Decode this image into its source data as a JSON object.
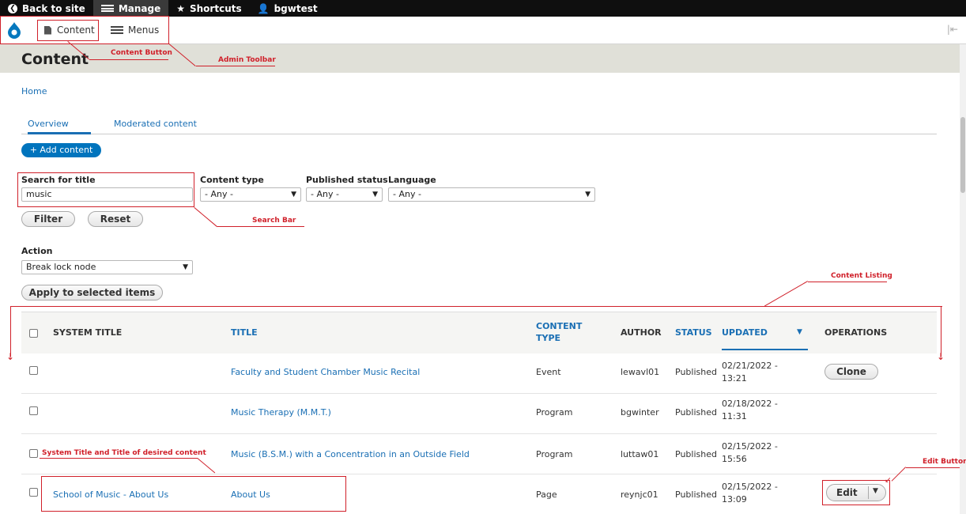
{
  "toolbar": {
    "back_to_site": "Back to site",
    "manage": "Manage",
    "shortcuts": "Shortcuts",
    "user": "bgwtest"
  },
  "tray": {
    "content": "Content",
    "menus": "Menus"
  },
  "page": {
    "title": "Content",
    "breadcrumb": "Home"
  },
  "tabs": [
    "Overview",
    "Moderated content"
  ],
  "add_content": "+ Add content",
  "filters": {
    "search_label": "Search for title",
    "search_value": "music",
    "content_type_label": "Content type",
    "content_type_value": "- Any -",
    "published_label": "Published status",
    "published_value": "- Any -",
    "language_label": "Language",
    "language_value": "- Any -",
    "filter_button": "Filter",
    "reset_button": "Reset"
  },
  "action": {
    "label": "Action",
    "value": "Break lock node",
    "apply_button": "Apply to selected items"
  },
  "table": {
    "headers": {
      "system_title": "SYSTEM TITLE",
      "title": "TITLE",
      "content_type_1": "CONTENT",
      "content_type_2": "TYPE",
      "author": "AUTHOR",
      "status": "STATUS",
      "updated": "UPDATED",
      "operations": "OPERATIONS"
    },
    "rows": [
      {
        "system_title": "",
        "title": "Faculty and Student Chamber Music Recital",
        "type": "Event",
        "author": "lewavl01",
        "status": "Published",
        "date": "02/21/2022 -",
        "time": "13:21",
        "operation": "Clone"
      },
      {
        "system_title": "",
        "title": "Music Therapy (M.M.T.)",
        "type": "Program",
        "author": "bgwinter",
        "status": "Published",
        "date": "02/18/2022 -",
        "time": "11:31",
        "operation": ""
      },
      {
        "system_title": "",
        "title": "Music (B.S.M.) with a Concentration in an Outside Field",
        "type": "Program",
        "author": "luttaw01",
        "status": "Published",
        "date": "02/15/2022 -",
        "time": "15:56",
        "operation": ""
      },
      {
        "system_title": "School of Music - About Us",
        "title": "About Us",
        "type": "Page",
        "author": "reynjc01",
        "status": "Published",
        "date": "02/15/2022 -",
        "time": "13:09",
        "operation": "Edit"
      }
    ]
  },
  "annotations": {
    "content_button": "Content Button",
    "admin_toolbar": "Admin Toolbar",
    "search_bar": "Search Bar",
    "content_listing": "Content Listing",
    "system_title": "System Title and Title of desired content",
    "edit_button": "Edit Button"
  },
  "colors": {
    "link": "#1a6fb4",
    "primary_button": "#0074bd",
    "annotation": "#d0202a",
    "toolbar": "#0f0f0f"
  }
}
